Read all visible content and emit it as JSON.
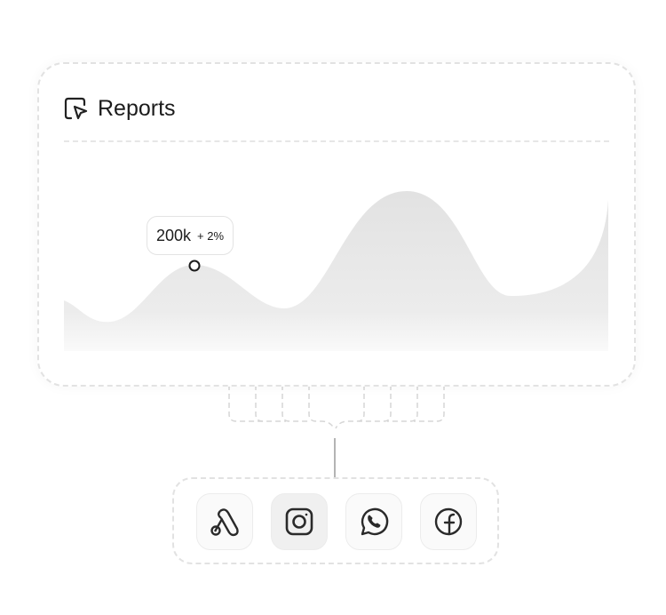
{
  "card": {
    "title": "Reports",
    "icon": "cursor-select-icon"
  },
  "tooltip": {
    "value": "200k",
    "delta": "+ 2%"
  },
  "chart_data": {
    "type": "area",
    "fill_color": "#e4e4e4",
    "highlight_point": "200k"
  },
  "integrations": [
    {
      "name": "google-ads",
      "icon": "google-ads-icon",
      "active": false
    },
    {
      "name": "instagram",
      "icon": "instagram-icon",
      "active": true
    },
    {
      "name": "whatsapp",
      "icon": "whatsapp-icon",
      "active": false
    },
    {
      "name": "facebook",
      "icon": "facebook-icon",
      "active": false
    }
  ]
}
